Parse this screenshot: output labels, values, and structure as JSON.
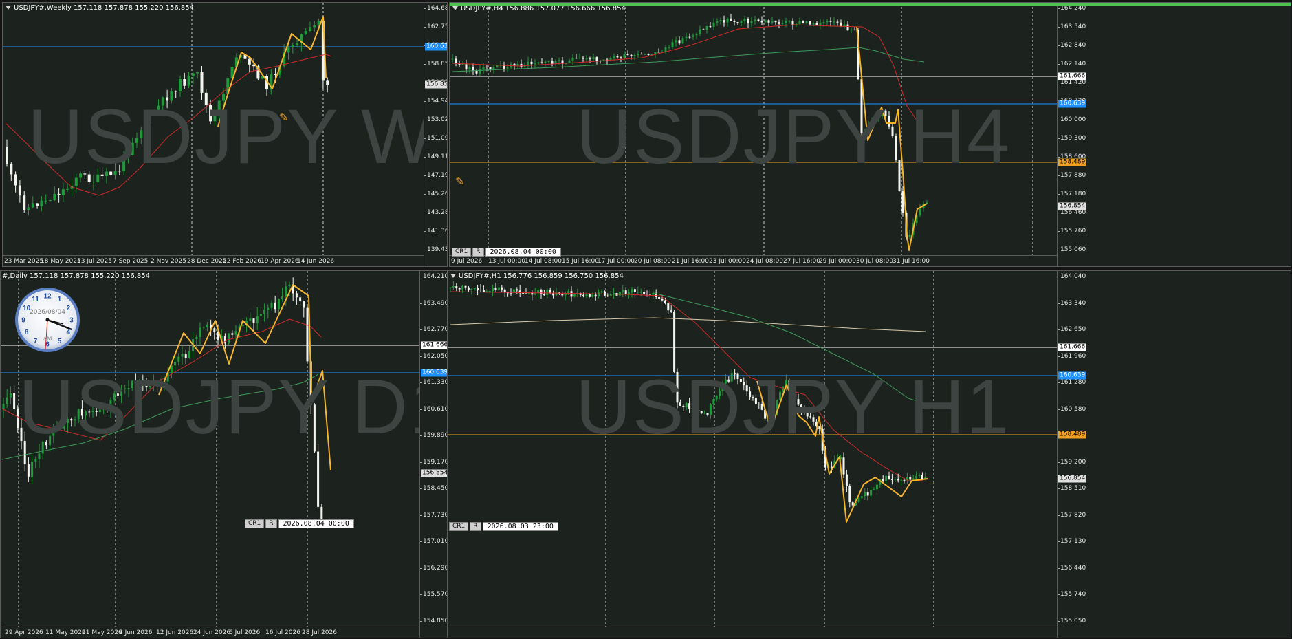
{
  "colors": {
    "bg": "#1c231f",
    "bull": "#1f9a3a",
    "bear": "#f5f5f0",
    "zigzag": "#f7b52a",
    "ma_fast": "#d22a2a",
    "ma_slow": "#3f9a5a",
    "ma_long": "#d9c9a8",
    "level_white": "#ffffff",
    "level_blue": "#1e90ff",
    "level_orange": "#f0a020",
    "level_green": "#1faa2a"
  },
  "panels": {
    "weekly": {
      "header": "USDJPY#,Weekly  157.118 157.878 155.220 156.854",
      "watermark": "USDJPY W1",
      "y_ticks": [
        "164.680",
        "162.755",
        "160.830",
        "158.850",
        "156.925",
        "154.945",
        "153.020",
        "151.095",
        "149.115",
        "147.190",
        "145.265",
        "143.285",
        "141.360",
        "139.435"
      ],
      "x_ticks": [
        "23 Mar 2025",
        "18 May 2025",
        "13 Jul 2025",
        "7 Sep 2025",
        "2 Nov 2025",
        "28 Dec 2025",
        "22 Feb 2026",
        "19 Apr 2026",
        "14 Jun 2026"
      ],
      "levels": [
        {
          "value": "160.639",
          "color": "blue"
        }
      ],
      "current_price": "156.854",
      "icon": "drawing-tool-icon"
    },
    "h4": {
      "header": "USDJPY#,H4  156.886 157.077 156.666 156.854",
      "watermark": "USDJPY H4",
      "y_ticks": [
        "164.240",
        "163.540",
        "162.840",
        "162.140",
        "161.420",
        "160.720",
        "160.000",
        "159.300",
        "158.600",
        "157.880",
        "157.180",
        "156.460",
        "155.760",
        "155.060"
      ],
      "x_ticks": [
        "9 Jul 2026",
        "13 Jul 00:00",
        "14 Jul 08:00",
        "15 Jul 16:00",
        "17 Jul 00:00",
        "20 Jul 08:00",
        "21 Jul 16:00",
        "23 Jul 00:00",
        "24 Jul 08:00",
        "27 Jul 16:00",
        "29 Jul 00:00",
        "30 Jul 08:00",
        "31 Jul 16:00"
      ],
      "levels": [
        {
          "value": "161.666",
          "color": "white"
        },
        {
          "value": "160.639",
          "color": "blue"
        },
        {
          "value": "158.489",
          "color": "orange"
        }
      ],
      "current_price": "156.854",
      "cr_label": "CR1",
      "r_label": "R",
      "date_label": "2026.08.04  00:00",
      "icon": "drawing-tool-icon"
    },
    "daily": {
      "header": "#,Daily  157.118 157.878 155.220 156.854",
      "watermark": "USDJPY D1",
      "y_ticks": [
        "164.210",
        "163.490",
        "162.770",
        "162.050",
        "161.330",
        "160.610",
        "159.890",
        "159.170",
        "158.450",
        "157.730",
        "157.010",
        "156.290",
        "155.570",
        "154.850"
      ],
      "x_ticks": [
        "29 Apr 2026",
        "11 May 2026",
        "21 May 2026",
        "2 Jun 2026",
        "12 Jun 2026",
        "24 Jun 2026",
        "6 Jul 2026",
        "16 Jul 2026",
        "28 Jul 2026"
      ],
      "levels": [
        {
          "value": "161.666",
          "color": "white"
        },
        {
          "value": "160.639",
          "color": "blue"
        }
      ],
      "current_price": "156.854",
      "cr_label": "CR1",
      "r_label": "R",
      "date_label": "2026.08.04  00:00",
      "clock_date": "2026/08/04",
      "clock_ampm": "AM",
      "clock_numbers": [
        "12",
        "1",
        "2",
        "3",
        "4",
        "5",
        "6",
        "7",
        "8",
        "9",
        "10",
        "11"
      ]
    },
    "h1": {
      "header": "USDJPY#,H1  156.776 156.859 156.750 156.854",
      "watermark": "USDJPY H1",
      "y_ticks": [
        "164.040",
        "163.340",
        "162.650",
        "161.960",
        "161.280",
        "160.580",
        "159.900",
        "159.200",
        "158.510",
        "157.820",
        "157.130",
        "156.440",
        "155.740",
        "155.050"
      ],
      "levels": [
        {
          "value": "161.666",
          "color": "white"
        },
        {
          "value": "160.639",
          "color": "blue"
        },
        {
          "value": "158.489",
          "color": "orange"
        }
      ],
      "current_price": "156.854",
      "cr_label": "CR1",
      "r_label": "R",
      "date_label": "2026.08.03  23:00"
    }
  }
}
